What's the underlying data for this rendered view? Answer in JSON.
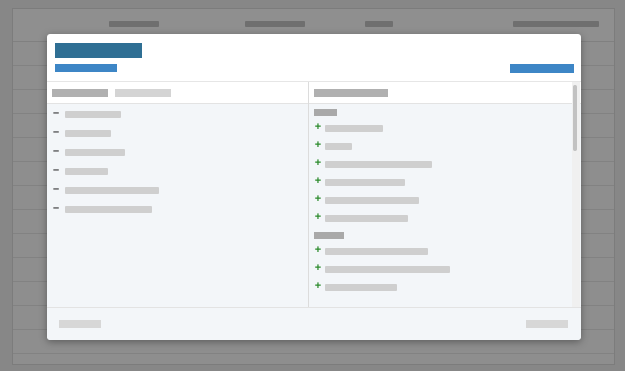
{
  "colors": {
    "title": "#2f6f94",
    "link": "#3d86c6",
    "primary_button": "#3d86c6",
    "placeholder": "#cfcfcf",
    "group_label": "#a9a9a9",
    "panel_bg": "#f3f6f9",
    "remove_sign": "#333333",
    "add_sign": "#2a8a2a"
  },
  "background": {
    "row_count": 13
  },
  "modal": {
    "left_panel": {
      "items": [
        {
          "sign": "–"
        },
        {
          "sign": "–"
        },
        {
          "sign": "–"
        },
        {
          "sign": "–"
        },
        {
          "sign": "–"
        },
        {
          "sign": "–"
        }
      ]
    },
    "right_panel": {
      "groups": [
        {
          "items": [
            {
              "sign": "+"
            },
            {
              "sign": "+"
            },
            {
              "sign": "+"
            },
            {
              "sign": "+"
            },
            {
              "sign": "+"
            },
            {
              "sign": "+"
            }
          ]
        },
        {
          "items": [
            {
              "sign": "+"
            },
            {
              "sign": "+"
            },
            {
              "sign": "+"
            }
          ]
        }
      ]
    }
  }
}
